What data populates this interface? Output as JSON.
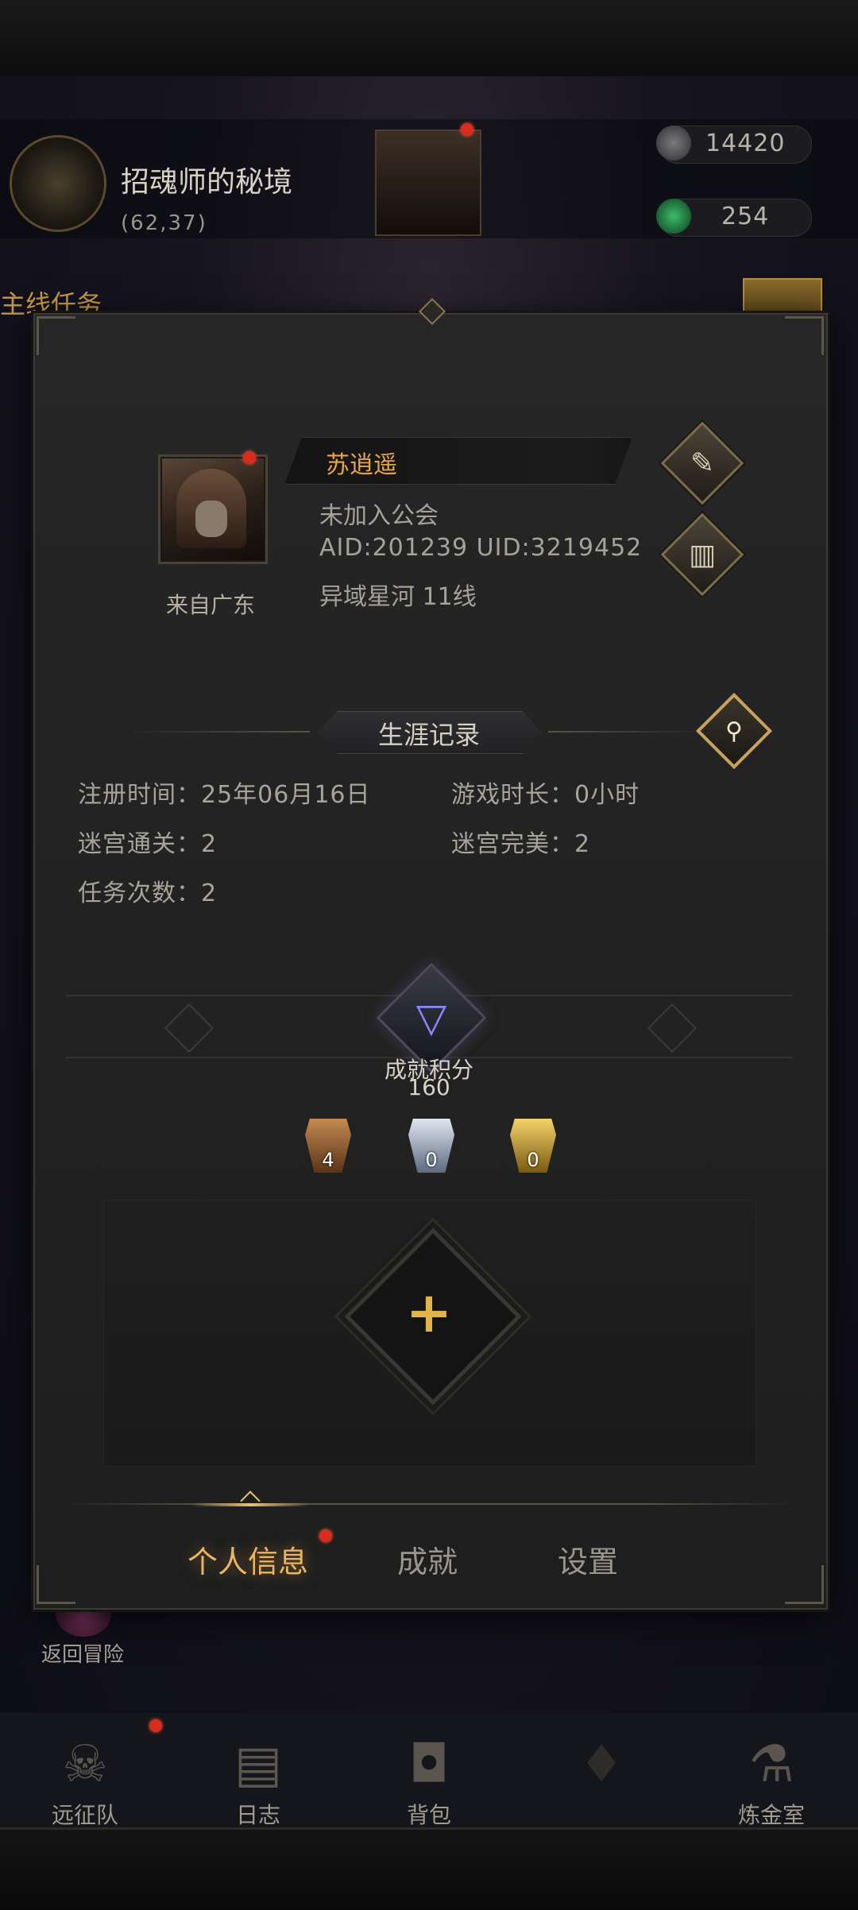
{
  "hud": {
    "map_name": "招魂师的秘境",
    "map_coord": "(62,37)",
    "resource_1": "14420",
    "resource_2": "254",
    "quest_tab": "主线任务"
  },
  "profile": {
    "name": "苏逍遥",
    "guild": "未加入公会",
    "ids": "AID:201239 UID:3219452",
    "server": "异域星河  11线",
    "from": "来自广东"
  },
  "career": {
    "title": "生涯记录",
    "register_time": "注册时间：25年06月16日",
    "play_time": "游戏时长：0小时",
    "maze_clear": "迷宫通关：2",
    "maze_perfect": "迷宫完美：2",
    "task_count": "任务次数：2"
  },
  "achievement": {
    "label": "成就积分",
    "score": "160",
    "medals": [
      {
        "count": "4",
        "color": "#9a6a3a"
      },
      {
        "count": "0",
        "color": "#a8b4c8"
      },
      {
        "count": "0",
        "color": "#c9a435"
      }
    ]
  },
  "tabs": {
    "personal": "个人信息",
    "achievements": "成就",
    "settings": "设置"
  },
  "back": {
    "label": "返回冒险"
  },
  "nav": {
    "expedition": "远征队",
    "log": "日志",
    "bag": "背包",
    "alchemy": "炼金室"
  },
  "icons": {
    "edit": "quill-icon",
    "copy": "scroll-icon",
    "search": "magnifier-icon",
    "add": "plus-icon"
  },
  "colors": {
    "accent_gold": "#e4a64a",
    "notification_red": "#d92b1e"
  }
}
